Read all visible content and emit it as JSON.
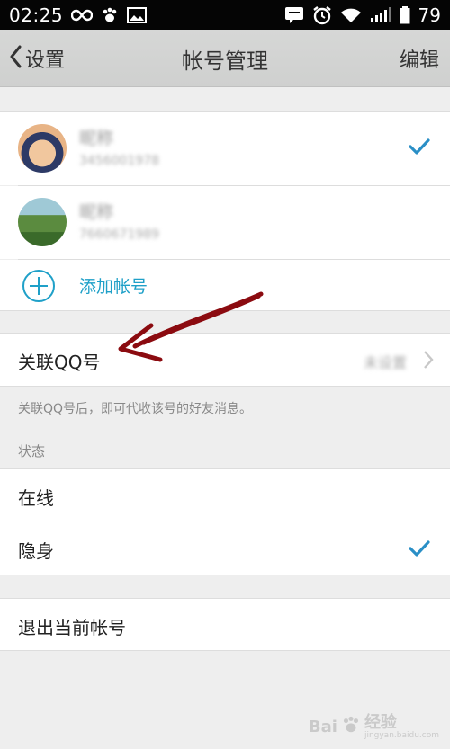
{
  "status_bar": {
    "time": "02:25",
    "battery": "79",
    "icons": [
      "infinity-icon",
      "paw-icon",
      "image-icon",
      "chat-icon",
      "alarm-icon",
      "wifi-icon",
      "signal-icon",
      "battery-icon"
    ]
  },
  "header": {
    "back_label": "设置",
    "title": "帐号管理",
    "edit_label": "编辑"
  },
  "accounts": [
    {
      "name": "昵称",
      "number": "3456001978",
      "selected": true
    },
    {
      "name": "昵称",
      "number": "7660671989",
      "selected": false
    }
  ],
  "add_account": {
    "label": "添加帐号"
  },
  "link_qq": {
    "label": "关联QQ号",
    "value": "未设置",
    "hint": "关联QQ号后，即可代收该号的好友消息。"
  },
  "status": {
    "section_label": "状态",
    "options": [
      {
        "label": "在线",
        "selected": false
      },
      {
        "label": "隐身",
        "selected": true
      }
    ]
  },
  "logout": {
    "label": "退出当前帐号"
  },
  "watermark": {
    "brand": "Bai",
    "sub": "经验",
    "url": "jingyan.baidu.com"
  },
  "colors": {
    "accent": "#1fa0c8",
    "check": "#2a8fc6",
    "annotation": "#8b0b10"
  }
}
